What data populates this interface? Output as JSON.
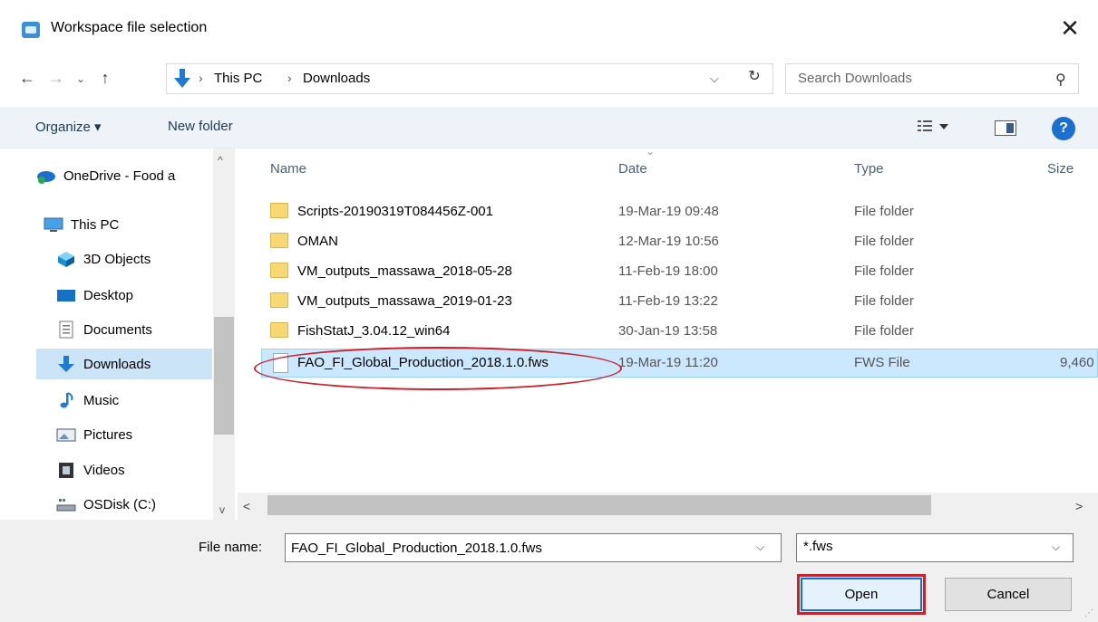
{
  "window": {
    "title": "Workspace file selection",
    "close": "✕"
  },
  "address": {
    "path": [
      "This PC",
      "Downloads"
    ],
    "separator": "›",
    "search_placeholder": "Search Downloads"
  },
  "toolbar": {
    "organize": "Organize ▾",
    "new_folder": "New folder"
  },
  "nav": {
    "items": [
      {
        "label": "OneDrive - Food a",
        "icon": "onedrive-icon"
      },
      {
        "label": "This PC",
        "icon": "pc-icon"
      },
      {
        "label": "3D Objects",
        "icon": "3d-objects-icon"
      },
      {
        "label": "Desktop",
        "icon": "desktop-icon"
      },
      {
        "label": "Documents",
        "icon": "documents-icon"
      },
      {
        "label": "Downloads",
        "icon": "downloads-icon"
      },
      {
        "label": "Music",
        "icon": "music-icon"
      },
      {
        "label": "Pictures",
        "icon": "pictures-icon"
      },
      {
        "label": "Videos",
        "icon": "videos-icon"
      },
      {
        "label": "OSDisk (C:)",
        "icon": "disk-icon"
      }
    ],
    "selected": "Downloads"
  },
  "files": {
    "columns": {
      "name": "Name",
      "date": "Date",
      "type": "Type",
      "size": "Size"
    },
    "rows": [
      {
        "name": "Scripts-20190319T084456Z-001",
        "date": "19-Mar-19 09:48",
        "type": "File folder",
        "size": ""
      },
      {
        "name": "OMAN",
        "date": "12-Mar-19 10:56",
        "type": "File folder",
        "size": ""
      },
      {
        "name": "VM_outputs_massawa_2018-05-28",
        "date": "11-Feb-19 18:00",
        "type": "File folder",
        "size": ""
      },
      {
        "name": "VM_outputs_massawa_2019-01-23",
        "date": "11-Feb-19 13:22",
        "type": "File folder",
        "size": ""
      },
      {
        "name": "FishStatJ_3.04.12_win64",
        "date": "30-Jan-19 13:58",
        "type": "File folder",
        "size": ""
      },
      {
        "name": "FAO_FI_Global_Production_2018.1.0.fws",
        "date": "19-Mar-19 11:20",
        "type": "FWS File",
        "size": "9,460"
      }
    ],
    "selected_index": 5
  },
  "bottom": {
    "file_name_label": "File name:",
    "file_name_value": "FAO_FI_Global_Production_2018.1.0.fws",
    "filter": "*.fws",
    "open": "Open",
    "cancel": "Cancel"
  },
  "colors": {
    "accent": "#0078d7",
    "annotation": "#c8232c",
    "selection": "#cce8ff"
  }
}
